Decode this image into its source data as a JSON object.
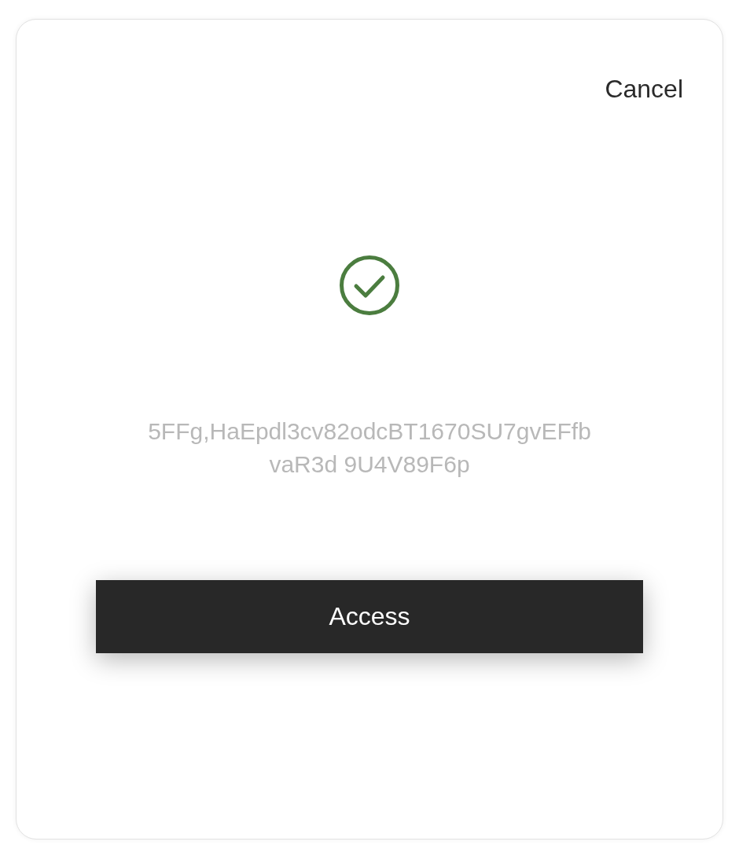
{
  "dialog": {
    "cancel": "Cancel",
    "verified": true,
    "token": "5FFg,HaEpdl3cv82odcBT1670SU7gvEFfb vaR3d 9U4V89F6p",
    "button": "Access"
  }
}
